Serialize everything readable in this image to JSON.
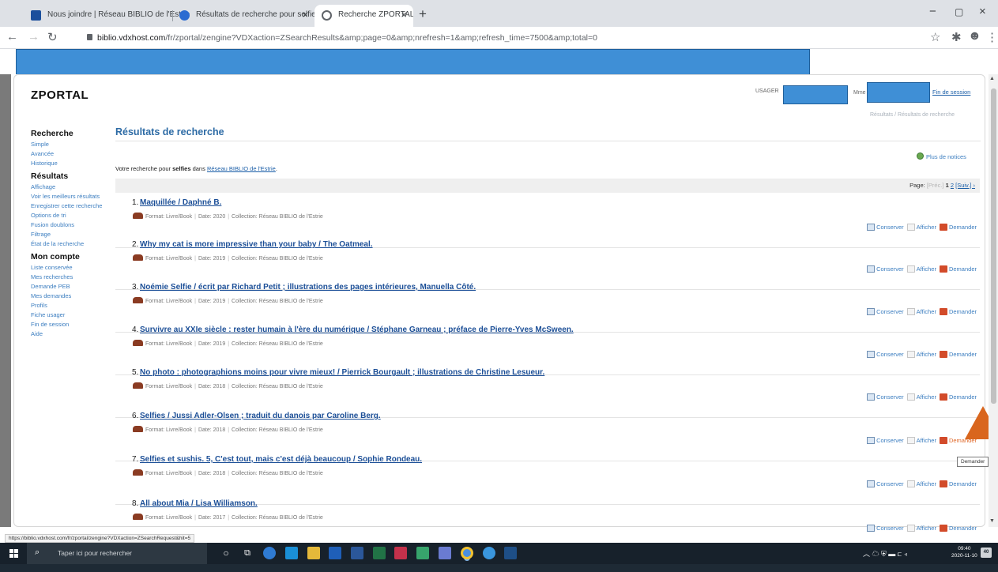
{
  "browser": {
    "tabs": [
      {
        "title": "Nous joindre | Réseau BIBLIO de l'Estrie",
        "active": false,
        "favicon_color": "#1b4f9c"
      },
      {
        "title": "Résultats de recherche pour selfies",
        "active": false,
        "favicon_color": "#2b6bd1"
      },
      {
        "title": "Recherche ZPORTAL",
        "active": true,
        "favicon_color": "#5f6368"
      }
    ],
    "url_host": "biblio.vdxhost.com",
    "url_path": "/fr/zportal/zengine?VDXaction=ZSearchResults&amp;page=0&amp;nrefresh=1&amp;refresh_time=7500&amp;total=0",
    "status_url": "https://biblio.vdxhost.com/fr/zportal/zengine?VDXaction=ZSearchRequest&hit=5"
  },
  "header": {
    "logo": "ZPORTAL",
    "usager_label": "USAGER",
    "mme_label": "Mme",
    "logout": "Fin de session",
    "breadcrumb": "Résultats / Résultats de recherche"
  },
  "sidebar": {
    "sections": [
      {
        "title": "Recherche",
        "items": [
          "Simple",
          "Avancée",
          "Historique"
        ]
      },
      {
        "title": "Résultats",
        "items": [
          "Affichage",
          "Voir les meilleurs résultats",
          "Enregistrer cette recherche",
          "Options de tri",
          "Fusion doublons",
          "Filtrage",
          "État de la recherche"
        ]
      },
      {
        "title": "Mon compte",
        "items": [
          "Liste conservée",
          "Mes recherches",
          "Demande PEB",
          "Mes demandes",
          "Profils",
          "Fiche usager",
          "Fin de session",
          "Aide"
        ]
      }
    ]
  },
  "main": {
    "title": "Résultats de recherche",
    "more_notices": "Plus de notices",
    "summary_prefix": "Votre recherche pour",
    "summary_term": "selfies",
    "summary_mid": "dans",
    "summary_catalog": "Réseau BIBLIO de l'Estrie",
    "pager": {
      "label": "Page:",
      "prev": "[Préc.]",
      "current": "1",
      "next_page": "2",
      "next": "[Suiv.] ›"
    },
    "actions": {
      "keep": "Conserver",
      "show": "Afficher",
      "request": "Demander"
    },
    "tooltip": "Demander",
    "results": [
      {
        "num": "1.",
        "title": "Maquillée / Daphné B.",
        "format": "Format: Livre/Book",
        "date": "Date: 2020",
        "collection": "Collection: Réseau BIBLIO de l'Estrie"
      },
      {
        "num": "2.",
        "title": "Why my cat is more impressive than your baby / The Oatmeal.",
        "format": "Format: Livre/Book",
        "date": "Date: 2019",
        "collection": "Collection: Réseau BIBLIO de l'Estrie"
      },
      {
        "num": "3.",
        "title": "Noémie Selfie / écrit par Richard Petit ; illustrations des pages intérieures, Manuella Côté.",
        "format": "Format: Livre/Book",
        "date": "Date: 2019",
        "collection": "Collection: Réseau BIBLIO de l'Estrie"
      },
      {
        "num": "4.",
        "title": "Survivre au XXIe siècle : rester humain à l'ère du numérique / Stéphane Garneau ; préface de Pierre-Yves McSween.",
        "format": "Format: Livre/Book",
        "date": "Date: 2019",
        "collection": "Collection: Réseau BIBLIO de l'Estrie"
      },
      {
        "num": "5.",
        "title": "No photo : photographions moins pour vivre mieux! / Pierrick Bourgault ; illustrations de Christine Lesueur.",
        "format": "Format: Livre/Book",
        "date": "Date: 2018",
        "collection": "Collection: Réseau BIBLIO de l'Estrie"
      },
      {
        "num": "6.",
        "title": "Selfies / Jussi Adler-Olsen ; traduit du danois par Caroline Berg.",
        "format": "Format: Livre/Book",
        "date": "Date: 2018",
        "collection": "Collection: Réseau BIBLIO de l'Estrie"
      },
      {
        "num": "7.",
        "title": "Selfies et sushis. 5, C'est tout, mais c'est déjà beaucoup / Sophie Rondeau.",
        "format": "Format: Livre/Book",
        "date": "Date: 2018",
        "collection": "Collection: Réseau BIBLIO de l'Estrie"
      },
      {
        "num": "8.",
        "title": "All about Mia / Lisa Williamson.",
        "format": "Format: Livre/Book",
        "date": "Date: 2017",
        "collection": "Collection: Réseau BIBLIO de l'Estrie"
      }
    ]
  },
  "taskbar": {
    "search_placeholder": "Taper ici pour rechercher",
    "time": "09:40",
    "date": "2020-11-10",
    "notifications": "40"
  },
  "colors": {
    "accent": "#2d6ba5",
    "link": "#1c4f97",
    "redaction": "#3f8fd6",
    "annotation": "#d9661e"
  }
}
